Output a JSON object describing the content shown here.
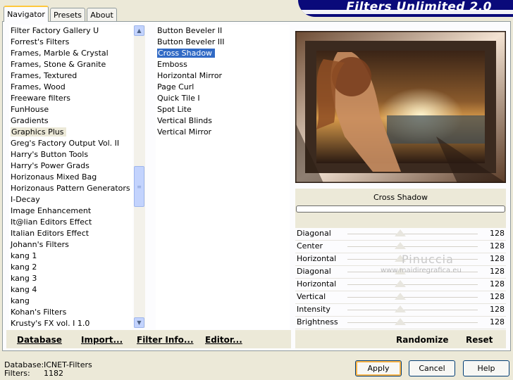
{
  "tabs": [
    {
      "label": "Navigator",
      "active": true
    },
    {
      "label": "Presets",
      "active": false
    },
    {
      "label": "About",
      "active": false
    }
  ],
  "banner_title": "Filters Unlimited 2.0",
  "categories": [
    "Filter Factory Gallery U",
    "Forrest's Filters",
    "Frames, Marble & Crystal",
    "Frames, Stone & Granite",
    "Frames, Textured",
    "Frames, Wood",
    "Freeware filters",
    "FunHouse",
    "Gradients",
    "Graphics Plus",
    "Greg's Factory Output Vol. II",
    "Harry's Button Tools",
    "Harry's Power Grads",
    "Horizonaus Mixed Bag",
    "Horizonaus Pattern Generators",
    "I-Decay",
    "Image Enhancement",
    "It@lian Editors Effect",
    "Italian Editors Effect",
    "Johann's Filters",
    "kang 1",
    "kang 2",
    "kang 3",
    "kang 4",
    "kang",
    "Kohan's Filters",
    "Krusty's FX vol. I 1.0"
  ],
  "selected_category": "Graphics Plus",
  "filters": [
    "Button Beveler II",
    "Button Beveler III",
    "Cross Shadow",
    "Emboss",
    "Horizontal Mirror",
    "Page Curl",
    "Quick Tile I",
    "Spot Lite",
    "Vertical Blinds",
    "Vertical Mirror"
  ],
  "selected_filter": "Cross Shadow",
  "left_buttons": {
    "database": "Database",
    "import": "Import...",
    "filter_info": "Filter Info...",
    "editor": "Editor..."
  },
  "filter_name_display": "Cross Shadow",
  "params": [
    {
      "name": "Diagonal",
      "value": "128"
    },
    {
      "name": "Center",
      "value": "128"
    },
    {
      "name": "Horizontal",
      "value": "128"
    },
    {
      "name": "Diagonal",
      "value": "128"
    },
    {
      "name": "Horizontal",
      "value": "128"
    },
    {
      "name": "Vertical",
      "value": "128"
    },
    {
      "name": "Intensity",
      "value": "128"
    },
    {
      "name": "Brightness",
      "value": "128"
    }
  ],
  "right_buttons": {
    "randomize": "Randomize",
    "reset": "Reset"
  },
  "watermark": {
    "line1": "Pinuccia",
    "line2": "www.maidiregrafica.eu"
  },
  "status": {
    "database_label": "Database:",
    "database_value": "ICNET-Filters",
    "filters_label": "Filters:",
    "filters_value": "1182"
  },
  "dialog_buttons": {
    "apply": "Apply",
    "cancel": "Cancel",
    "help": "Help"
  }
}
